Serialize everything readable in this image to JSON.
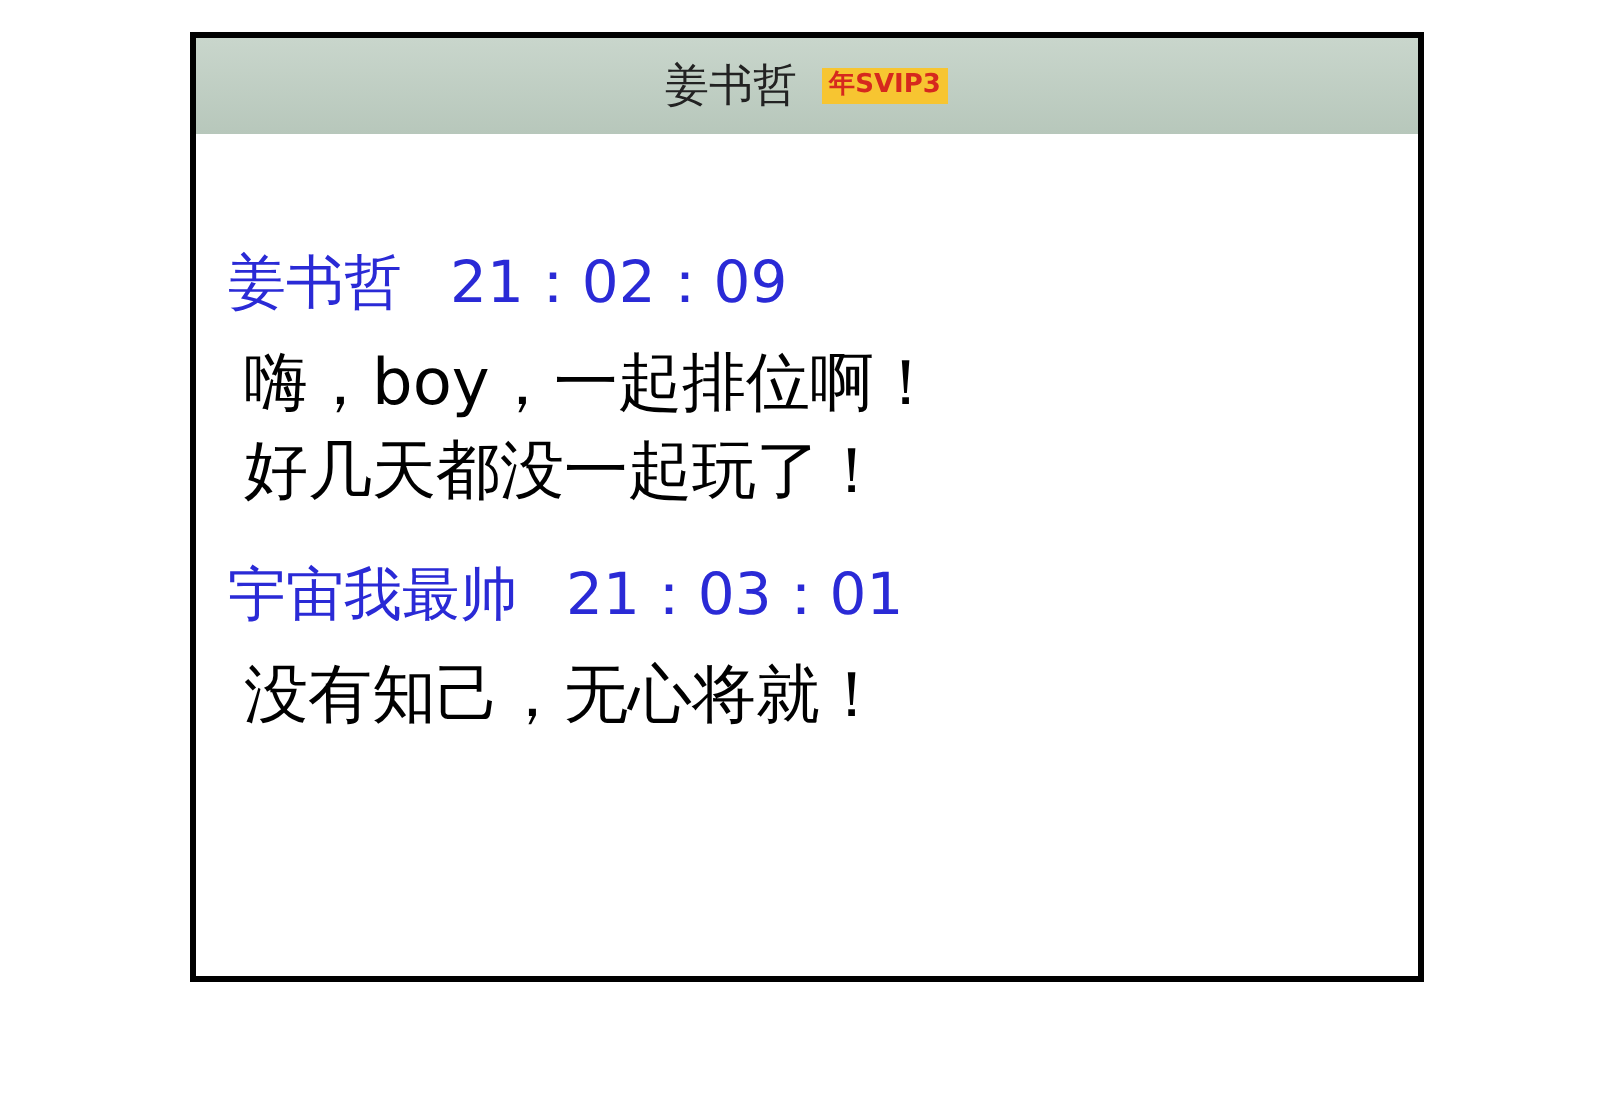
{
  "header": {
    "title": "姜书哲",
    "badge": "年SVIP3"
  },
  "messages": [
    {
      "sender": "姜书哲",
      "time": "21：02：09",
      "lines": [
        "嗨，boy，一起排位啊！",
        "好几天都没一起玩了！"
      ]
    },
    {
      "sender": "宇宙我最帅",
      "time": "21：03：01",
      "lines": [
        "没有知己，无心将就！"
      ]
    }
  ]
}
